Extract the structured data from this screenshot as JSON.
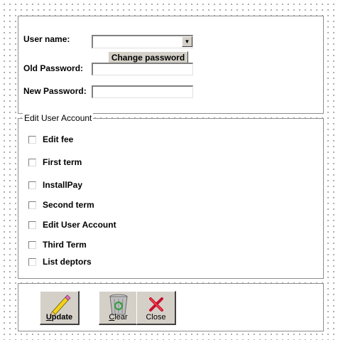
{
  "login": {
    "username_label": "User name:",
    "username_value": "",
    "change_password_label": "Change password",
    "old_password_label": "Old Password:",
    "old_password_value": "",
    "new_password_label": "New Password:",
    "new_password_value": ""
  },
  "edit_account": {
    "title": "Edit User Account",
    "items": [
      {
        "label": "Edit fee",
        "checked": false
      },
      {
        "label": "First term",
        "checked": false
      },
      {
        "label": "InstallPay",
        "checked": false
      },
      {
        "label": "Second term",
        "checked": false
      },
      {
        "label": "Edit User Account",
        "checked": false
      },
      {
        "label": "Third Term",
        "checked": false
      },
      {
        "label": "List deptors",
        "checked": false
      }
    ]
  },
  "actions": {
    "update_label": "Update",
    "clear_label": "Clear",
    "close_label": "Close"
  },
  "icons": {
    "update": "pencil-icon",
    "clear": "recycle-bin-icon",
    "close": "red-x-icon",
    "combo": "chevron-down-icon"
  }
}
